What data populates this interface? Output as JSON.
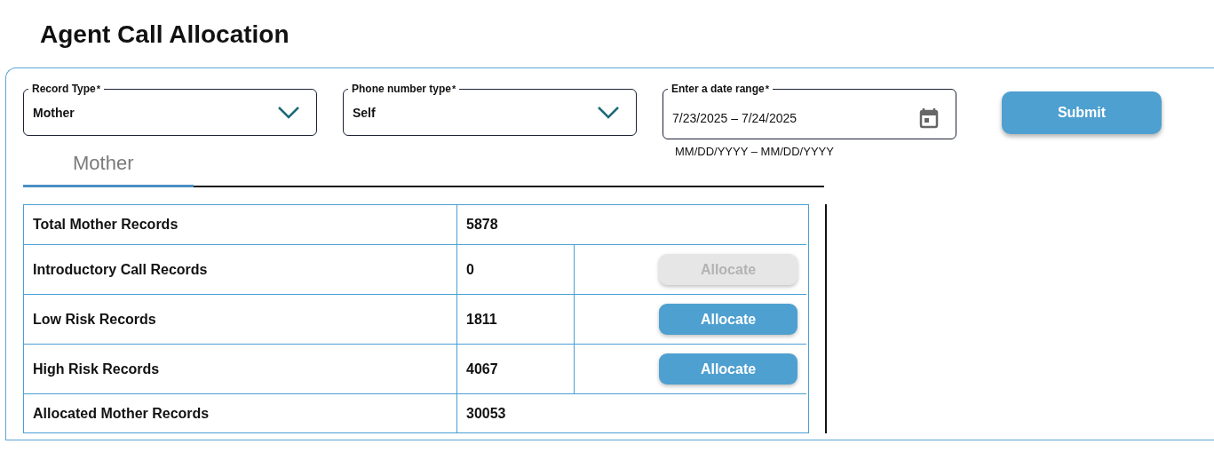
{
  "page_title": "Agent Call Allocation",
  "filters": [
    {
      "kind": "select",
      "label": "Record Type",
      "required_mark": "*",
      "value": "Mother"
    },
    {
      "kind": "select",
      "label": "Phone number type",
      "required_mark": "*",
      "value": "Self"
    },
    {
      "kind": "daterange",
      "label": "Enter a date range",
      "required_mark": "*",
      "start": "7/23/2025",
      "separator": "–",
      "end": "7/24/2025",
      "helper": "MM/DD/YYYY – MM/DD/YYYY"
    }
  ],
  "submit_button": "Submit",
  "tabs": [
    {
      "label": "Mother",
      "selected": true
    }
  ],
  "table": {
    "rows": [
      {
        "kind": "plain",
        "label": "Total Mother Records",
        "value": "5878"
      },
      {
        "kind": "allocate",
        "label": "Introductory Call Records",
        "value": "0",
        "button": "Allocate",
        "disabled": true
      },
      {
        "kind": "allocate",
        "label": "Low Risk Records",
        "value": "1811",
        "button": "Allocate",
        "disabled": false
      },
      {
        "kind": "allocate",
        "label": "High Risk Records",
        "value": "4067",
        "button": "Allocate",
        "disabled": false
      },
      {
        "kind": "plain",
        "label": "Allocated Mother Records",
        "value": "30053"
      }
    ]
  }
}
